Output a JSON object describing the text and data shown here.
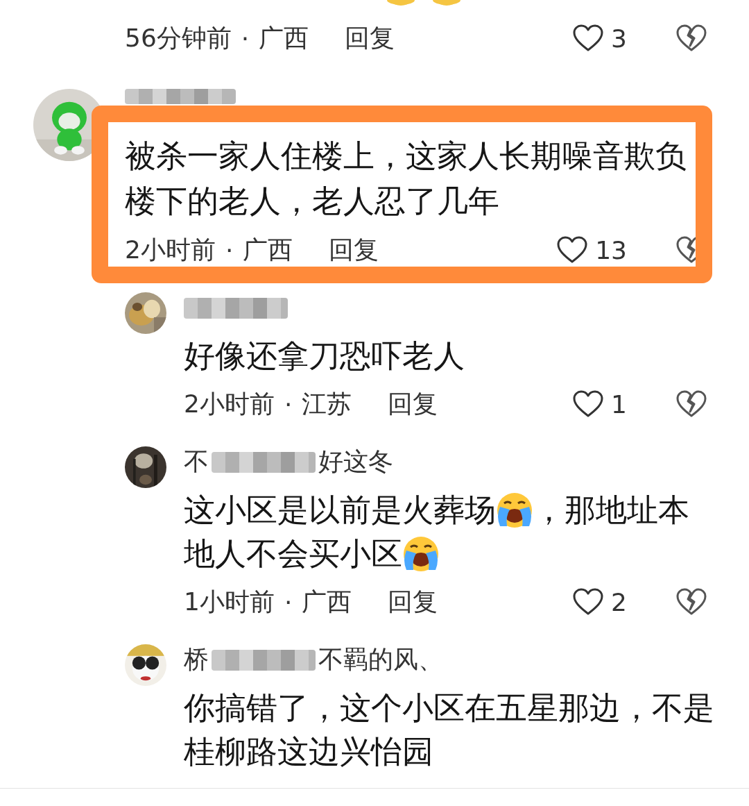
{
  "top_comment": {
    "meta": {
      "time": "56分钟前",
      "separator": "·",
      "region": "广西",
      "reply": "回复",
      "likes": "3"
    }
  },
  "comments": [
    {
      "kind": "comment",
      "highlighted": true,
      "name_parts": [
        {
          "kind": "redacted"
        }
      ],
      "lines": [
        [
          {
            "kind": "text",
            "text": "被杀一家人住楼上，这家人长期噪音欺负"
          }
        ],
        [
          {
            "kind": "text",
            "text": "楼下的老人，老人忍了几年"
          }
        ]
      ],
      "meta": {
        "time": "2小时前",
        "separator": "·",
        "region": "广西",
        "reply": "回复",
        "likes": "13"
      }
    },
    {
      "kind": "reply",
      "highlighted": false,
      "name_parts": [
        {
          "kind": "redacted"
        }
      ],
      "lines": [
        [
          {
            "kind": "text",
            "text": "好像还拿刀恐吓老人"
          }
        ]
      ],
      "meta": {
        "time": "2小时前",
        "separator": "·",
        "region": "江苏",
        "reply": "回复",
        "likes": "1"
      }
    },
    {
      "kind": "reply",
      "highlighted": false,
      "name_parts": [
        {
          "kind": "text",
          "text": "不"
        },
        {
          "kind": "redacted"
        },
        {
          "kind": "text",
          "text": "好这冬"
        }
      ],
      "lines": [
        [
          {
            "kind": "text",
            "text": "这小区是以前是火葬场"
          },
          {
            "kind": "emoji"
          },
          {
            "kind": "text",
            "text": "，那地址本"
          }
        ],
        [
          {
            "kind": "text",
            "text": "地人不会买小区"
          },
          {
            "kind": "emoji"
          }
        ]
      ],
      "meta": {
        "time": "1小时前",
        "separator": "·",
        "region": "广西",
        "reply": "回复",
        "likes": "2"
      }
    },
    {
      "kind": "reply",
      "highlighted": false,
      "name_parts": [
        {
          "kind": "text",
          "text": "桥"
        },
        {
          "kind": "redacted"
        },
        {
          "kind": "text",
          "text": "不羁的风、"
        }
      ],
      "lines": [
        [
          {
            "kind": "text",
            "text": "你搞错了，这个小区在五星那边，不是"
          }
        ],
        [
          {
            "kind": "text",
            "text": "桂柳路这边兴怡园"
          }
        ]
      ]
    }
  ]
}
